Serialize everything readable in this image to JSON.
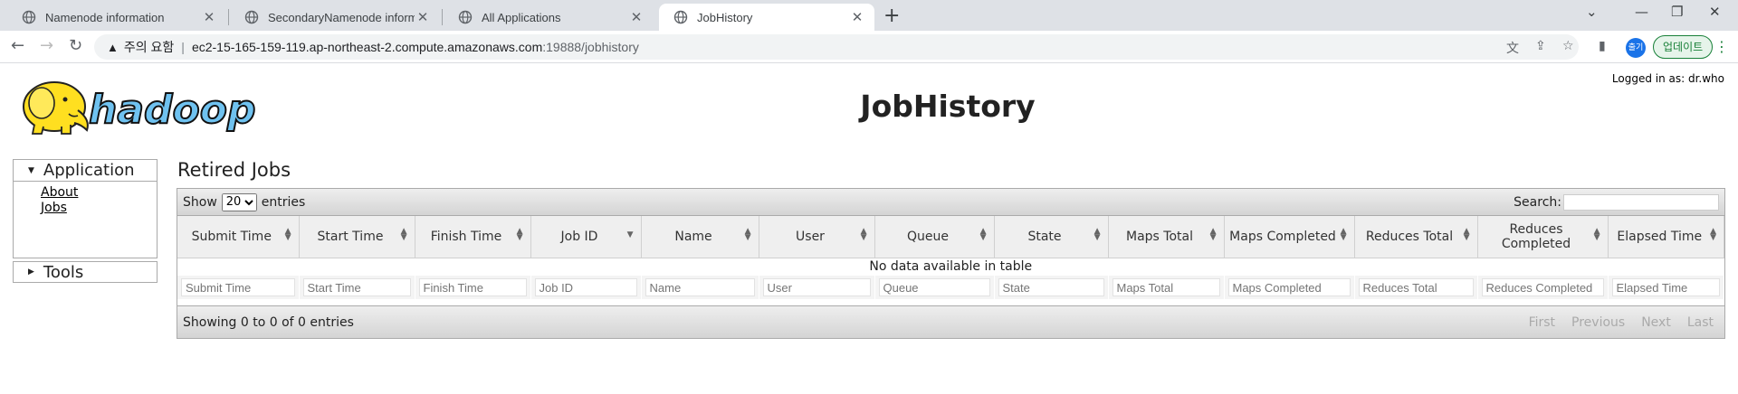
{
  "browser": {
    "tabs": [
      {
        "title": "Namenode information",
        "active": false
      },
      {
        "title": "SecondaryNamenode information",
        "active": false
      },
      {
        "title": "All Applications",
        "active": false
      },
      {
        "title": "JobHistory",
        "active": true
      }
    ],
    "address": {
      "warning_label": "주의 요함",
      "divider": "|",
      "host": "ec2-15-165-159-119.ap-northeast-2.compute.amazonaws.com",
      "path": ":19888/jobhistory"
    },
    "profile_initials": "출기",
    "update_label": "업데이트"
  },
  "header": {
    "logged_in": "Logged in as: dr.who",
    "title": "JobHistory",
    "logo_text": "hadoop"
  },
  "sidebar": {
    "sections": [
      {
        "label": "Application",
        "expanded": true,
        "links": [
          "About",
          "Jobs"
        ]
      },
      {
        "label": "Tools",
        "expanded": false,
        "links": []
      }
    ]
  },
  "main": {
    "section_title": "Retired Jobs",
    "show_label": "Show",
    "page_size": "20",
    "page_size_options": [
      "20"
    ],
    "entries_label": "entries",
    "search_label": "Search:",
    "columns": [
      "Submit Time",
      "Start Time",
      "Finish Time",
      "Job ID",
      "Name",
      "User",
      "Queue",
      "State",
      "Maps Total",
      "Maps Completed",
      "Reduces Total",
      "Reduces Completed",
      "Elapsed Time"
    ],
    "empty_message": "No data available in table",
    "filters": [
      "Submit Time",
      "Start Time",
      "Finish Time",
      "Job ID",
      "Name",
      "User",
      "Queue",
      "State",
      "Maps Total",
      "Maps Completed",
      "Reduces Total",
      "Reduces Completed",
      "Elapsed Time"
    ],
    "info": "Showing 0 to 0 of 0 entries",
    "pager": [
      "First",
      "Previous",
      "Next",
      "Last"
    ]
  }
}
